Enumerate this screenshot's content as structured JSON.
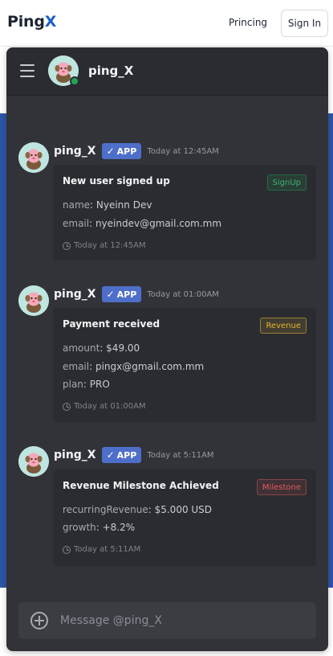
{
  "nav": {
    "logo_main": "Ping",
    "logo_accent": "X",
    "pricing_label": "Princing",
    "signin_label": "Sign In"
  },
  "channel": {
    "name": "ping_X",
    "status": "online"
  },
  "colors": {
    "brand_blue": "#1f5fc9",
    "backdrop": "#2f55a8",
    "app_badge": "#4e6fc9",
    "online": "#23a559"
  },
  "messages": [
    {
      "author": "ping_X",
      "badge": "APP",
      "time": "Today at 12:45AM",
      "title": "New user signed up",
      "tag": "SignUp",
      "tag_color": "green",
      "fields": [
        {
          "key": "name",
          "value": "Nyeinn Dev"
        },
        {
          "key": "email",
          "value": "nyeindev@gmail.com.mm"
        }
      ],
      "footer_time": "Today at 12:45AM"
    },
    {
      "author": "ping_X",
      "badge": "APP",
      "time": "Today at 01:00AM",
      "title": "Payment received",
      "tag": "Revenue",
      "tag_color": "yellow",
      "fields": [
        {
          "key": "amount",
          "value": "$49.00"
        },
        {
          "key": "email",
          "value": "pingx@gmail.com.mm"
        },
        {
          "key": "plan",
          "value": "PRO"
        }
      ],
      "footer_time": "Today at 01:00AM"
    },
    {
      "author": "ping_X",
      "badge": "APP",
      "time": "Today at 5:11AM",
      "title": "Revenue Milestone Achieved",
      "tag": "Milestone",
      "tag_color": "red",
      "fields": [
        {
          "key": "recurringRevenue",
          "value": "$5.000 USD"
        },
        {
          "key": "growth",
          "value": "+8.2%"
        }
      ],
      "footer_time": "Today at 5:11AM"
    }
  ],
  "composer": {
    "placeholder": "Message @ping_X"
  }
}
